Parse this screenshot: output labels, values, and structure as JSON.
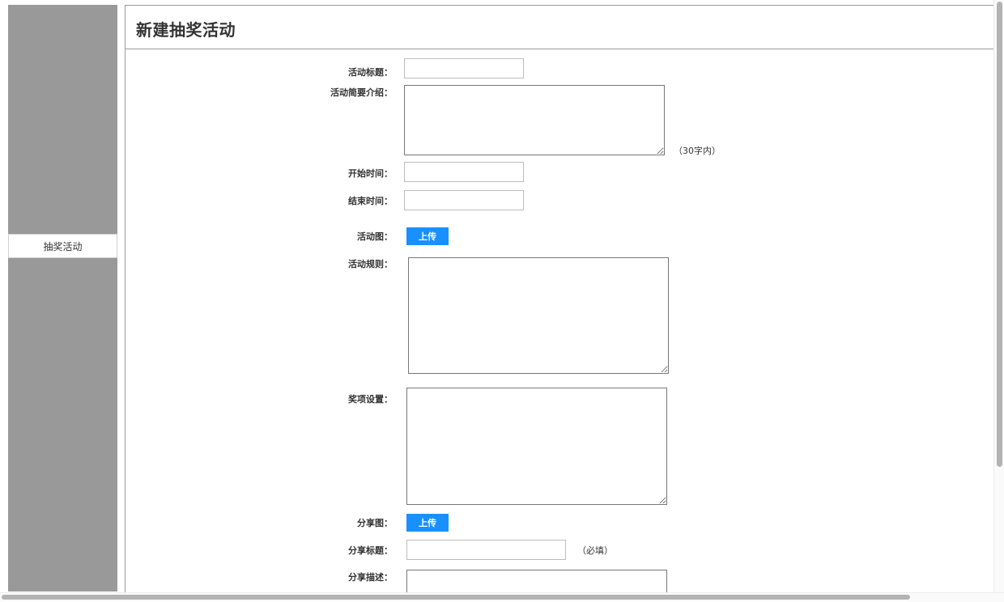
{
  "sidebar": {
    "items": [
      {
        "label": "抽奖活动"
      }
    ]
  },
  "page": {
    "title": "新建抽奖活动"
  },
  "form": {
    "activity_title": {
      "label": "活动标题：",
      "value": ""
    },
    "activity_intro": {
      "label": "活动简要介绍：",
      "value": "",
      "hint": "（30字内）"
    },
    "start_time": {
      "label": "开始时间：",
      "value": ""
    },
    "end_time": {
      "label": "结束时间：",
      "value": ""
    },
    "activity_image": {
      "label": "活动图：",
      "button": "上传"
    },
    "activity_rules": {
      "label": "活动规则：",
      "value": ""
    },
    "prize_settings": {
      "label": "奖项设置：",
      "value": ""
    },
    "share_image": {
      "label": "分享图：",
      "button": "上传"
    },
    "share_title": {
      "label": "分享标题：",
      "value": "",
      "hint": "（必填）"
    },
    "share_description": {
      "label": "分享描述：",
      "value": ""
    }
  },
  "colors": {
    "sidebar_bg": "#999999",
    "accent": "#1890ff",
    "text": "#333333"
  }
}
